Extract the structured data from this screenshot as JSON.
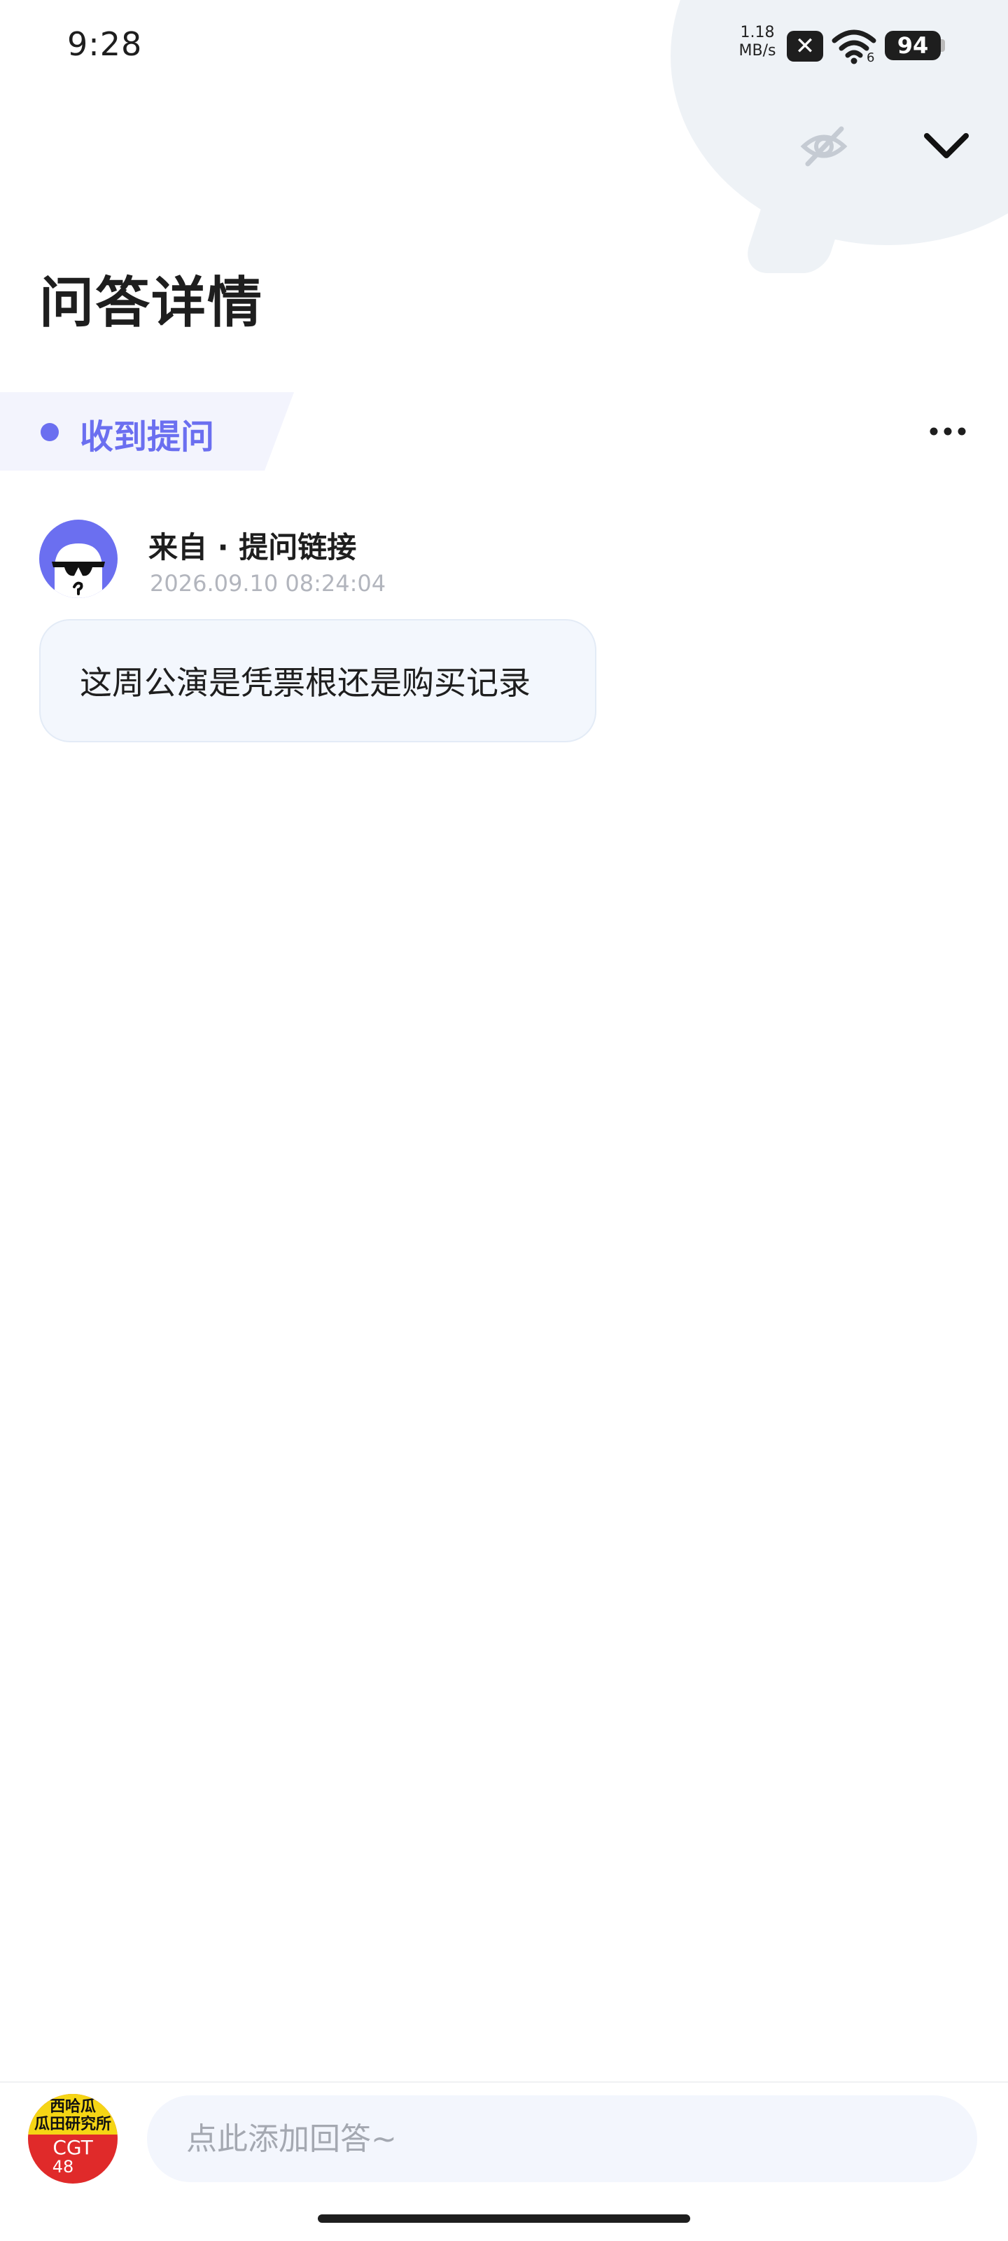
{
  "status_bar": {
    "time": "9:28",
    "net_speed_value": "1.18",
    "net_speed_unit": "MB/s",
    "no_sim_symbol": "✕",
    "wifi_badge": "6",
    "battery_level": "94"
  },
  "header": {
    "hide_icon": "eye-off-icon",
    "collapse_icon": "chevron-down-icon",
    "title": "问答详情"
  },
  "section": {
    "label": "收到提问",
    "accent_color": "#6b6ff0",
    "more_icon": "more-horizontal-icon"
  },
  "question": {
    "from": "来自 · 提问链接",
    "timestamp": "2026.09.10 08:24:04",
    "text": "这周公演是凭票根还是购买记录"
  },
  "avatar_logo": {
    "line1": "西哈瓜",
    "line2": "瓜田研究所",
    "line3": "CGT",
    "line4": "48"
  },
  "answer_bar": {
    "placeholder": "点此添加回答~"
  }
}
